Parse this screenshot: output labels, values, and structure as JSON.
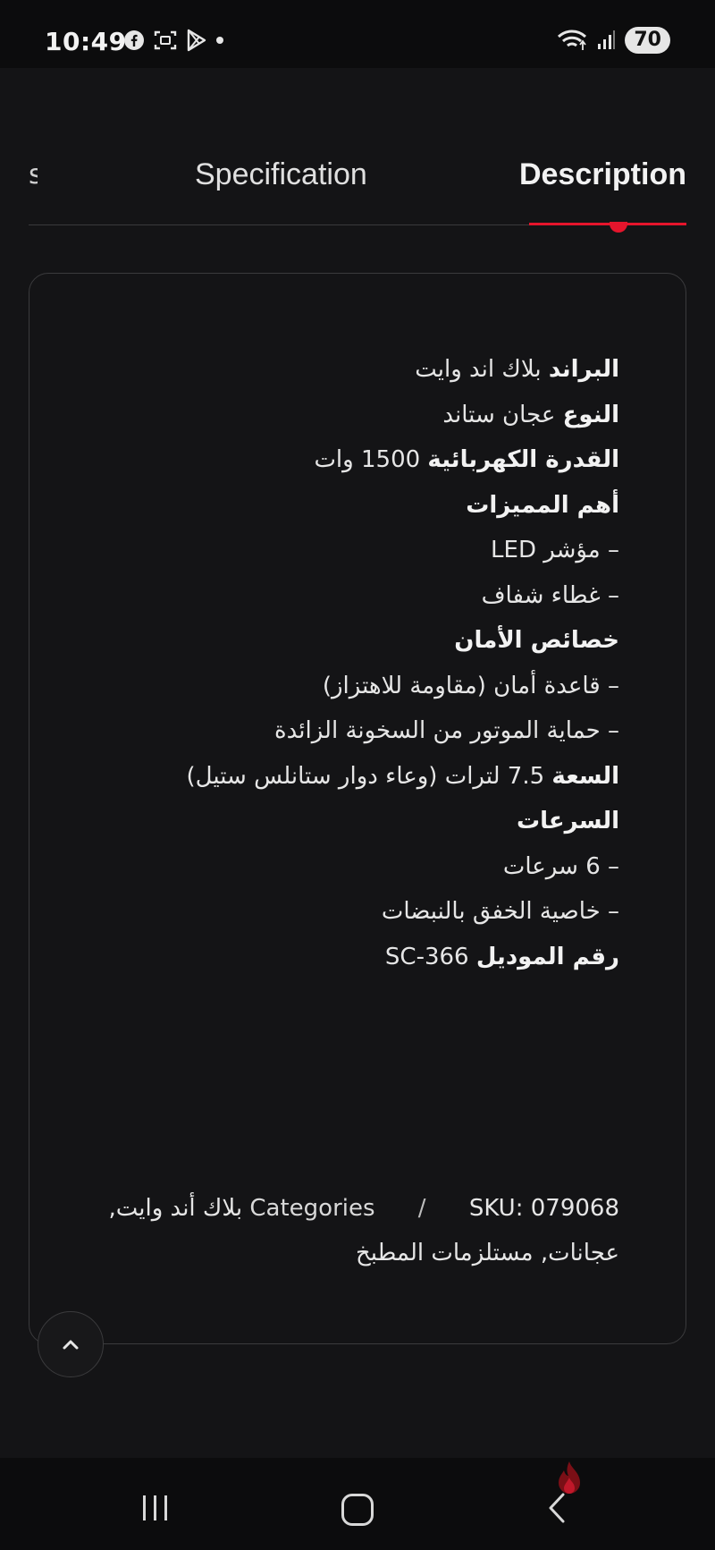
{
  "status_bar": {
    "time": "10:49",
    "left_icons": [
      "facebook-icon",
      "screenshot-icon",
      "play-store-icon",
      "dot-icon"
    ],
    "right_icons": [
      "wifi-icon",
      "signal-icon"
    ],
    "battery": "70"
  },
  "tabs": {
    "partial": "s",
    "specification": "Specification",
    "description": "Description",
    "active": "Description",
    "accent_color": "#e5152c"
  },
  "description": {
    "brand_label": "البراند",
    "brand_value": "بلاك اند وايت",
    "type_label": "النوع",
    "type_value": "عجان ستاند",
    "power_label": "القدرة الكهربائية",
    "power_value": "1500 وات",
    "features_title": "أهم المميزات",
    "feature_1": "– مؤشر LED",
    "feature_2": "– غطاء شفاف",
    "safety_title": "خصائص الأمان",
    "safety_1": "– قاعدة أمان (مقاومة للاهتزاز)",
    "safety_2": "– حماية الموتور من السخونة الزائدة",
    "capacity_label": "السعة",
    "capacity_value": "7.5 لترات (وعاء دوار ستانلس ستيل)",
    "speeds_title": "السرعات",
    "speed_1": "– 6 سرعات",
    "speed_2": "– خاصية الخفق بالنبضات",
    "model_label": "رقم الموديل",
    "model_value": "SC-366"
  },
  "meta": {
    "sku": "SKU: 079068",
    "separator": "/",
    "categories_label": "Categories",
    "categories_line1": "بلاك أند وايت,",
    "categories_line2": "عجانات, مستلزمات المطبخ"
  },
  "scroll_top": {
    "icon": "chevron-up-icon"
  },
  "nav_bar": {
    "icons": [
      "recent-apps-icon",
      "home-icon",
      "back-icon"
    ]
  }
}
